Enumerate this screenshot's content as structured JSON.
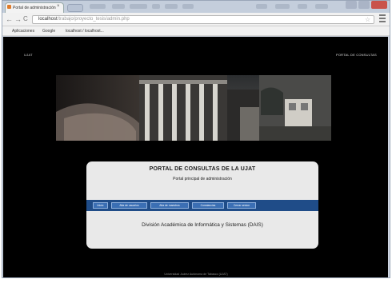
{
  "browser": {
    "tab_title": "Portal de administración",
    "tab_close": "×",
    "nav": {
      "back": "←",
      "forward": "→",
      "reload": "C"
    },
    "address": {
      "host": "localhost",
      "path": "/trabajo/proyecto_tesis/admin.php"
    },
    "bookmarks": [
      {
        "label": "Aplicaciones",
        "icon": "apps-grid-icon",
        "color": "#d6d6d6"
      },
      {
        "label": "Google",
        "icon": "google-icon",
        "color": "#4a7fd6"
      },
      {
        "label": "localhost / localhost...",
        "icon": "folder-icon",
        "color": "#e4b142"
      }
    ]
  },
  "page": {
    "brand": "UJAT",
    "top_right_link": "PORTAL DE CONSULTAS",
    "card": {
      "title": "PORTAL DE CONSULTAS DE LA UJAT",
      "subtitle": "Portal principal de administración",
      "menu": [
        "Inicio",
        "Alta de usuarios",
        "Alta de maestros",
        "Constancias",
        "Cerrar sesion"
      ],
      "division": "División Académica de Informática y Sistemas (DAIS)"
    },
    "footer": "Universidad Juárez Autónoma de Tabasco (UJAT)"
  },
  "colors": {
    "page_bg": "#000000",
    "card_bg": "#e9e9e9",
    "menu_bar": "#1f4c88",
    "menu_button": "#3b6fb4"
  }
}
